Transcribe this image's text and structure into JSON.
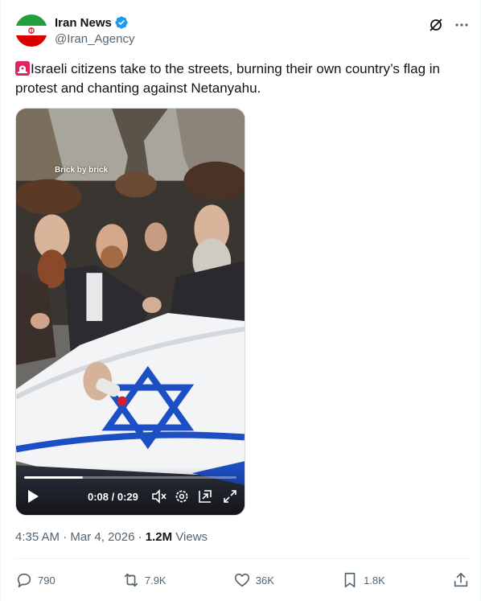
{
  "author": {
    "display_name": "Iran News",
    "handle": "@Iran_Agency",
    "verified": true
  },
  "tweet": {
    "emoji": "rotating-light-icon",
    "text": "Israeli citizens take to the streets, burning their own country’s flag in protest and chanting against Netanyahu."
  },
  "video": {
    "watermark": "Brick by brick",
    "time": "0:08 / 0:29",
    "progress": 0.276
  },
  "meta": {
    "time": "4:35 AM",
    "separator": "·",
    "date": "Mar 4, 2026",
    "views_count": "1.2M",
    "views_label": "Views"
  },
  "actions": {
    "replies": "790",
    "reposts": "7.9K",
    "likes": "36K",
    "bookmarks": "1.8K"
  },
  "colors": {
    "text_primary": "#0f1419",
    "text_secondary": "#536471",
    "verified_blue": "#1d9bf0",
    "flag_blue": "#1d4fc4"
  }
}
